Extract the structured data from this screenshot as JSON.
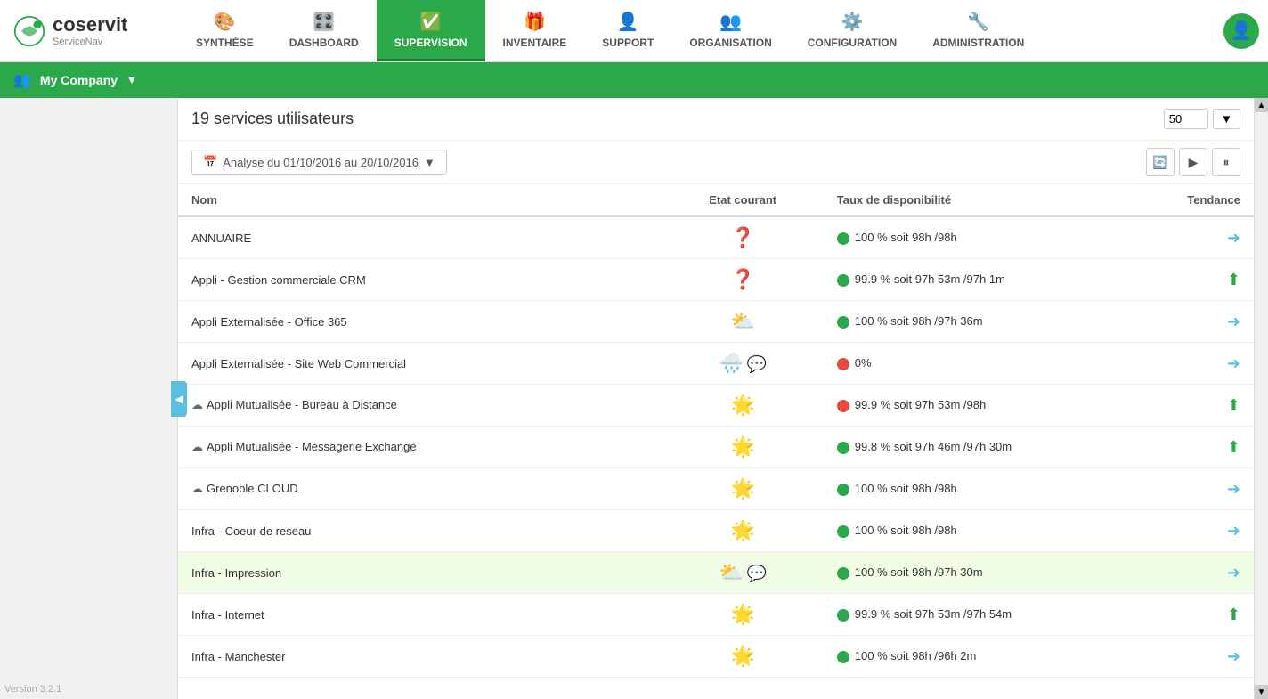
{
  "logo": {
    "brand": "coservit",
    "product": "ServiceNav"
  },
  "nav": {
    "items": [
      {
        "id": "synthese",
        "label": "SYNTHÈSE",
        "icon": "🎨",
        "active": false
      },
      {
        "id": "dashboard",
        "label": "DASHBOARD",
        "icon": "🎛️",
        "active": false
      },
      {
        "id": "supervision",
        "label": "SUPERVISION",
        "icon": "✅",
        "active": true
      },
      {
        "id": "inventaire",
        "label": "INVENTAIRE",
        "icon": "🎁",
        "active": false
      },
      {
        "id": "support",
        "label": "SUPPORT",
        "icon": "👤",
        "active": false
      },
      {
        "id": "organisation",
        "label": "ORGANISATION",
        "icon": "👥",
        "active": false
      },
      {
        "id": "configuration",
        "label": "CONFIGURATION",
        "icon": "⚙️",
        "active": false
      },
      {
        "id": "administration",
        "label": "ADMINISTRATION",
        "icon": "🔧",
        "active": false
      }
    ]
  },
  "company_bar": {
    "icon": "👥",
    "name": "My Company",
    "dropdown_label": "▼"
  },
  "content": {
    "title": "19 services utilisateurs",
    "per_page_value": "50",
    "date_filter": "Analyse du 01/10/2016 au 20/10/2016",
    "columns": {
      "nom": "Nom",
      "etat": "Etat courant",
      "taux": "Taux de disponibilité",
      "tendance": "Tendance"
    },
    "rows": [
      {
        "id": 1,
        "nom": "ANNUAIRE",
        "cloud": false,
        "etat_icon": "❓",
        "etat_color": "orange",
        "dot": "green",
        "taux": "100 % soit 98h /98h",
        "tendance": "right",
        "highlighted": false,
        "comment": false
      },
      {
        "id": 2,
        "nom": "Appli - Gestion commerciale CRM",
        "cloud": false,
        "etat_icon": "❓",
        "etat_color": "orange",
        "dot": "green",
        "taux": "99.9 % soit 97h 53m /97h 1m",
        "tendance": "up",
        "highlighted": false,
        "comment": false
      },
      {
        "id": 3,
        "nom": "Appli Externalisée - Office 365",
        "cloud": false,
        "etat_icon": "⛅",
        "etat_color": "",
        "dot": "green",
        "taux": "100 % soit 98h /97h 36m",
        "tendance": "right",
        "highlighted": false,
        "comment": false
      },
      {
        "id": 4,
        "nom": "Appli Externalisée - Site Web Commercial",
        "cloud": false,
        "etat_icon": "🌧️",
        "etat_color": "",
        "dot": "red",
        "taux": "0%",
        "tendance": "right",
        "highlighted": false,
        "comment": true
      },
      {
        "id": 5,
        "nom": "Appli Mutualisée - Bureau à Distance",
        "cloud": true,
        "etat_icon": "🌟",
        "etat_color": "",
        "dot": "red",
        "taux": "99.9 % soit 97h 53m /98h",
        "tendance": "up",
        "highlighted": false,
        "comment": false
      },
      {
        "id": 6,
        "nom": "Appli Mutualisée - Messagerie Exchange",
        "cloud": true,
        "etat_icon": "🌟",
        "etat_color": "",
        "dot": "green",
        "taux": "99.8 % soit 97h 46m /97h 30m",
        "tendance": "up",
        "highlighted": false,
        "comment": false
      },
      {
        "id": 7,
        "nom": "Grenoble CLOUD",
        "cloud": true,
        "etat_icon": "🌟",
        "etat_color": "",
        "dot": "green",
        "taux": "100 % soit 98h /98h",
        "tendance": "right",
        "highlighted": false,
        "comment": false
      },
      {
        "id": 8,
        "nom": "Infra - Coeur de reseau",
        "cloud": false,
        "etat_icon": "🌟",
        "etat_color": "",
        "dot": "green",
        "taux": "100 % soit 98h /98h",
        "tendance": "right",
        "highlighted": false,
        "comment": false
      },
      {
        "id": 9,
        "nom": "Infra - Impression",
        "cloud": false,
        "etat_icon": "⛅",
        "etat_color": "",
        "dot": "green",
        "taux": "100 % soit 98h /97h 30m",
        "tendance": "right",
        "highlighted": true,
        "comment": true
      },
      {
        "id": 10,
        "nom": "Infra - Internet",
        "cloud": false,
        "etat_icon": "🌟",
        "etat_color": "",
        "dot": "green",
        "taux": "99.9 % soit 97h 53m /97h 54m",
        "tendance": "up",
        "highlighted": false,
        "comment": false
      },
      {
        "id": 11,
        "nom": "Infra - Manchester",
        "cloud": false,
        "etat_icon": "🌟",
        "etat_color": "",
        "dot": "green",
        "taux": "100 % soit 98h /96h 2m",
        "tendance": "right",
        "highlighted": false,
        "comment": false
      }
    ]
  },
  "sidebar_toggle": "◀",
  "version": "Version 3.2.1"
}
